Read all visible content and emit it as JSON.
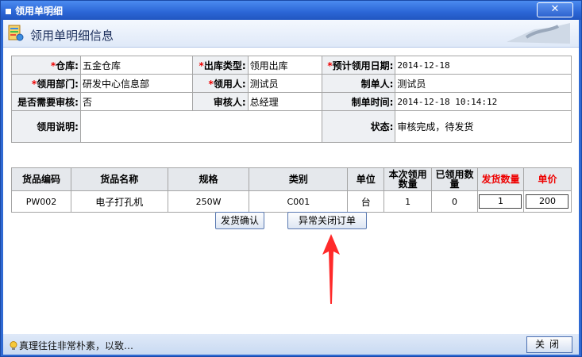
{
  "window": {
    "title": "领用单明细",
    "close_glyph": "✕"
  },
  "header": {
    "title": "领用单明细信息"
  },
  "info": {
    "warehouse_label": "仓库:",
    "warehouse": "五金仓库",
    "out_type_label": "出库类型:",
    "out_type": "领用出库",
    "plan_date_label": "预计领用日期:",
    "plan_date": "2014-12-18",
    "dept_label": "领用部门:",
    "dept": "研发中心信息部",
    "user_label": "领用人:",
    "user": "测试员",
    "maker_label": "制单人:",
    "maker": "测试员",
    "need_review_label": "是否需要审核:",
    "need_review": "否",
    "reviewer_label": "审核人:",
    "reviewer": "总经理",
    "make_time_label": "制单时间:",
    "make_time": "2014-12-18 10:14:12",
    "remark_label": "领用说明:",
    "remark": "",
    "state_label": "状态:",
    "state": "审核完成，待发货"
  },
  "goods": {
    "headers": [
      "货品编码",
      "货品名称",
      "规格",
      "类别",
      "单位",
      "本次领用数量",
      "已领用数量",
      "发货数量",
      "单价"
    ],
    "rows": [
      {
        "code": "PW002",
        "name": "电子打孔机",
        "spec": "250W",
        "category": "C001",
        "unit": "台",
        "req_qty": "1",
        "done_qty": "0",
        "ship_qty": "1",
        "price": "200"
      }
    ]
  },
  "actions": {
    "confirm": "发货确认",
    "abnormal_close": "异常关闭订单"
  },
  "status": {
    "tip": "真理往往非常朴素，以致…",
    "close": "关闭"
  },
  "colors": {
    "required": "#ee0000",
    "arrow": "#ff2a2a",
    "titlebar": "#2b66d6"
  }
}
